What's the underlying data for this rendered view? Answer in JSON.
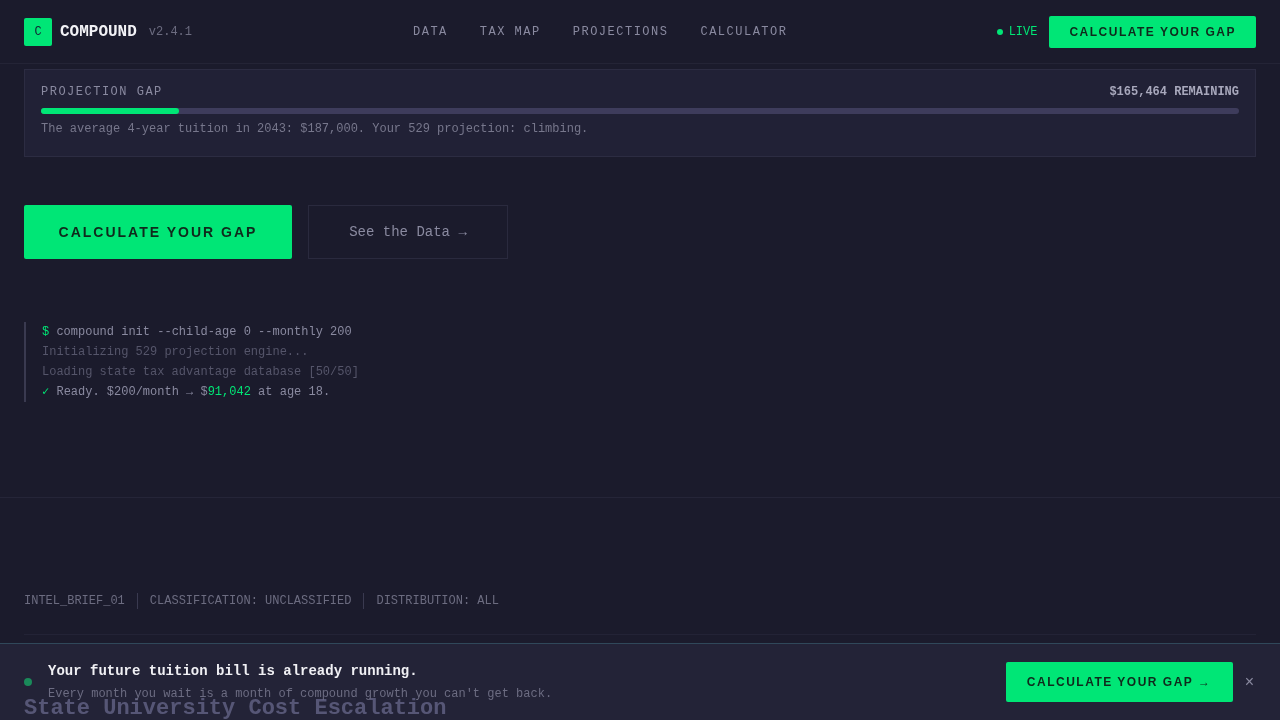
{
  "header": {
    "logo_mark": "C",
    "brand": "COMPOUND",
    "version": "v2.4.1",
    "nav": [
      {
        "label": "DATA"
      },
      {
        "label": "TAX MAP"
      },
      {
        "label": "PROJECTIONS"
      },
      {
        "label": "CALCULATOR"
      }
    ],
    "status": "LIVE",
    "cta": "CALCULATE YOUR GAP"
  },
  "gap": {
    "label": "PROJECTION GAP",
    "remaining": "$165,464 REMAINING",
    "level": 0.115,
    "note": "The average 4-year tuition in 2043: $187,000. Your 529 projection: climbing."
  },
  "actions": {
    "primary": "CALCULATE YOUR GAP",
    "secondary": "See the Data →"
  },
  "terminal": [
    {
      "kind": "command",
      "prompt": "$",
      "text": "compound init --child-age 0 --monthly 200"
    },
    {
      "kind": "log",
      "text": "Initializing 529 projection engine..."
    },
    {
      "kind": "log",
      "text": "Loading state tax advantage database [50/50]"
    },
    {
      "kind": "result",
      "prompt": "✓",
      "text": "Ready. $200/month → $",
      "highlight": "91,042",
      "after": " at age 18."
    }
  ],
  "meta": [
    "INTEL_BRIEF_01",
    "CLASSIFICATION: UNCLASSIFIED",
    "DISTRIBUTION: ALL"
  ],
  "section_heading": "State University Cost Escalation",
  "banner": {
    "title": "Your future tuition bill is already running.",
    "text": "Every month you wait is a month of compound growth you can't get back.",
    "cta": "CALCULATE YOUR GAP →",
    "close": "×"
  }
}
